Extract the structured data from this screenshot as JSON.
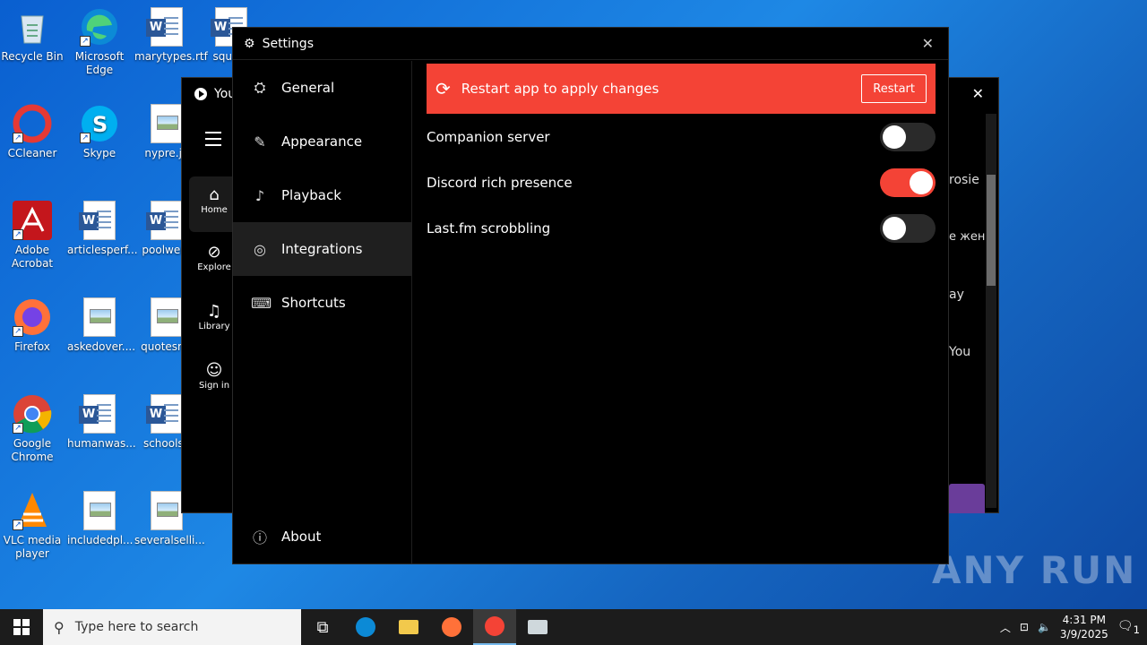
{
  "desktop": {
    "icons": [
      {
        "label": "Recycle Bin"
      },
      {
        "label": "Microsoft Edge"
      },
      {
        "label": "marytypes.rtf"
      },
      {
        "label": "square"
      },
      {
        "label": "CCleaner"
      },
      {
        "label": "Skype"
      },
      {
        "label": "nypre.jp"
      },
      {
        "label": "Adobe Acrobat"
      },
      {
        "label": "articlesperf..."
      },
      {
        "label": "poolwent"
      },
      {
        "label": "Firefox"
      },
      {
        "label": "askedover...."
      },
      {
        "label": "quotesret"
      },
      {
        "label": "Google Chrome"
      },
      {
        "label": "humanwas..."
      },
      {
        "label": "schoolse"
      },
      {
        "label": "VLC media player"
      },
      {
        "label": "includedpl..."
      },
      {
        "label": "severalselli..."
      }
    ]
  },
  "background_app": {
    "title": "You",
    "nav": [
      {
        "label": "Home"
      },
      {
        "label": "Explore"
      },
      {
        "label": "Library"
      },
      {
        "label": "Sign in"
      }
    ],
    "partial_texts": [
      "rosie",
      "е женщ",
      "ay",
      "You"
    ]
  },
  "settings": {
    "title": "Settings",
    "sidebar": {
      "items": [
        {
          "label": "General",
          "icon": "gear-icon"
        },
        {
          "label": "Appearance",
          "icon": "brush-icon"
        },
        {
          "label": "Playback",
          "icon": "music-note-icon"
        },
        {
          "label": "Integrations",
          "icon": "integrations-icon"
        },
        {
          "label": "Shortcuts",
          "icon": "keyboard-icon"
        }
      ],
      "about_label": "About",
      "active": "Integrations"
    },
    "banner": {
      "message": "Restart app to apply changes",
      "button_label": "Restart",
      "color": "#f44336"
    },
    "options": [
      {
        "label": "Companion server",
        "enabled": false
      },
      {
        "label": "Discord rich presence",
        "enabled": true
      },
      {
        "label": "Last.fm scrobbling",
        "enabled": false
      }
    ]
  },
  "taskbar": {
    "search_placeholder": "Type here to search",
    "time": "4:31 PM",
    "date": "3/9/2025",
    "notification_count": "1"
  },
  "watermark": "ANY RUN"
}
